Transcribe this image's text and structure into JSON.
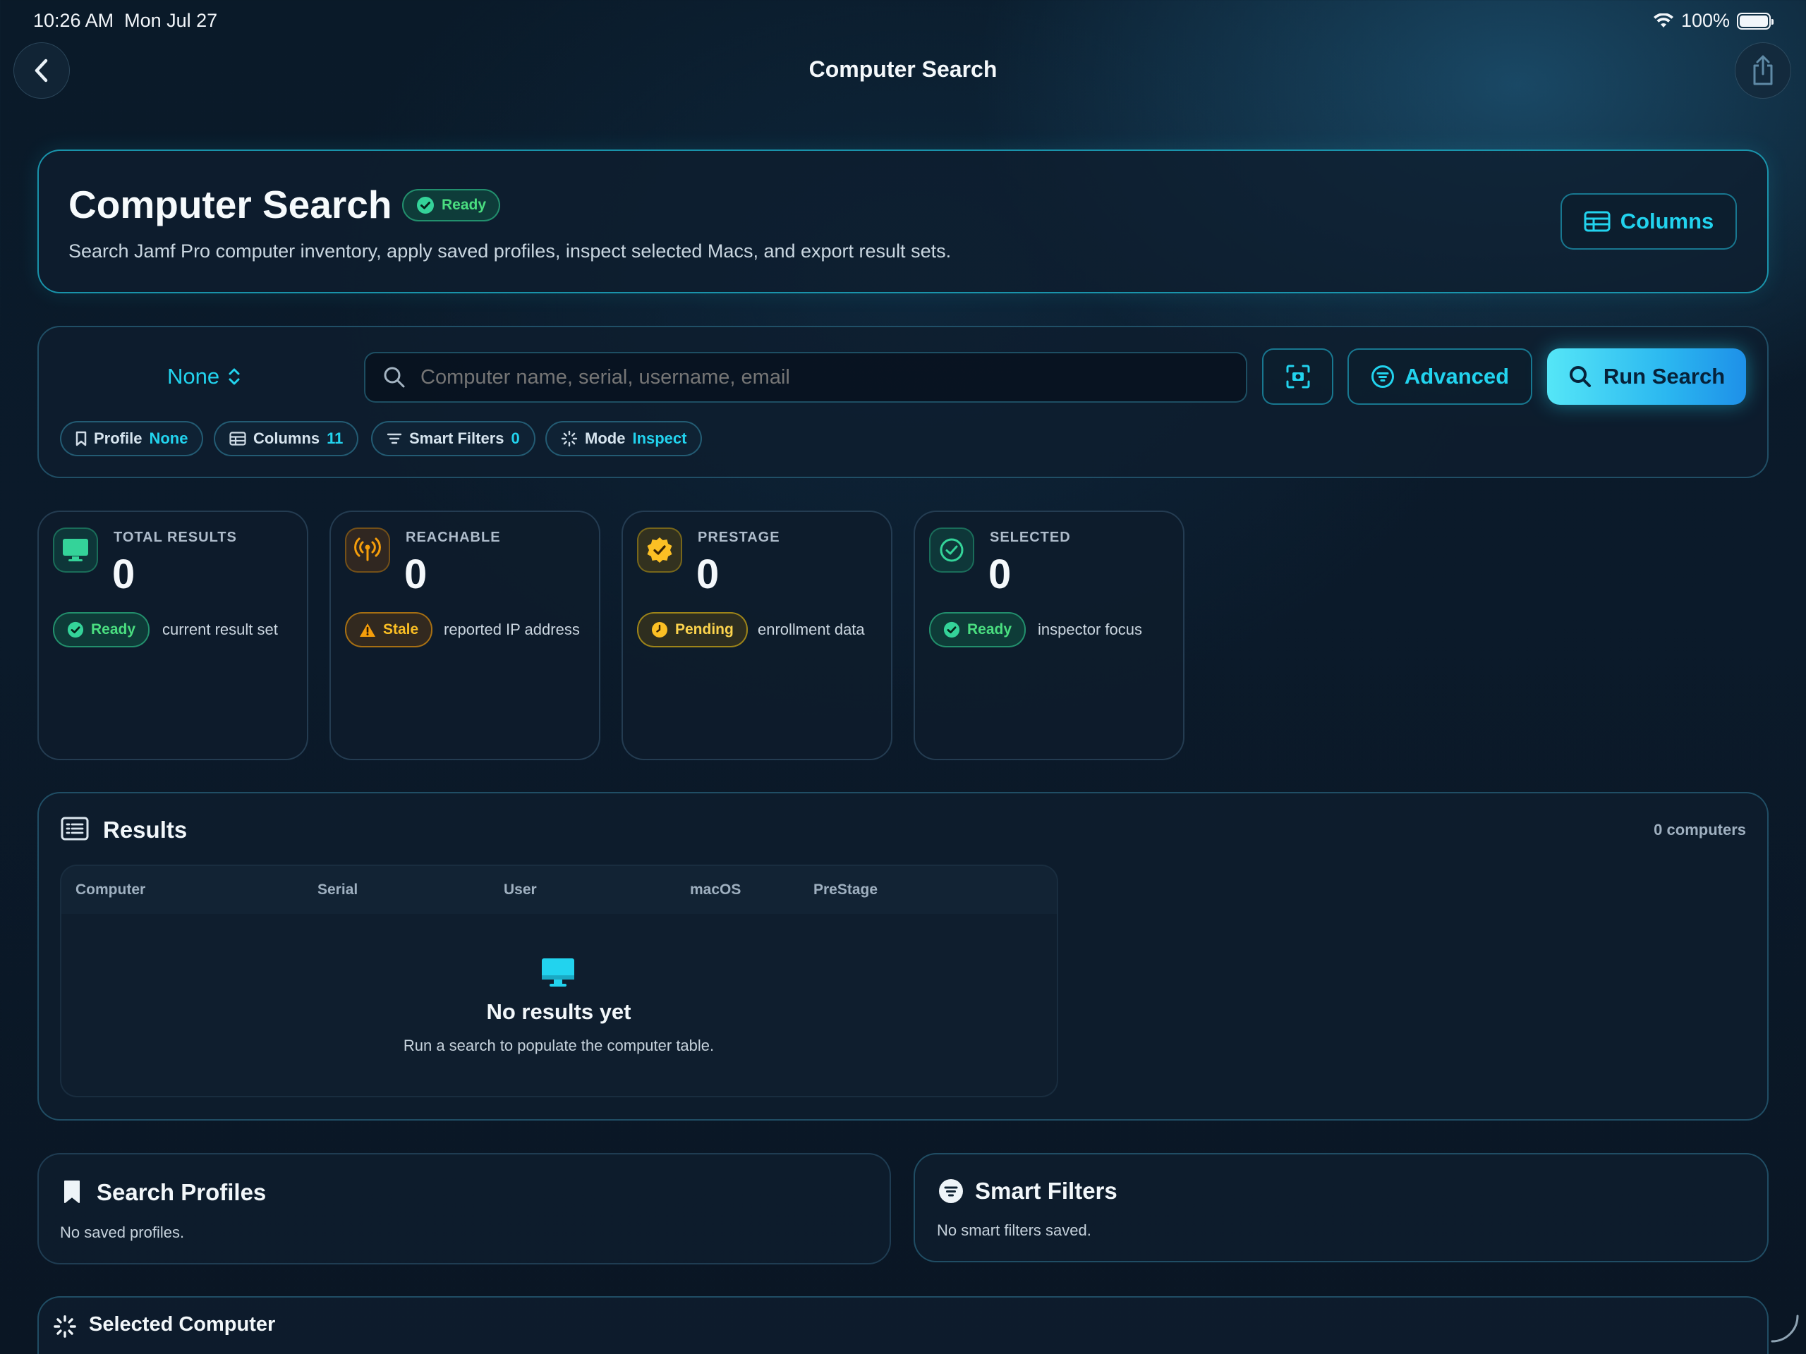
{
  "status_bar": {
    "time": "10:26 AM",
    "date": "Mon Jul 27",
    "battery": "100%"
  },
  "nav": {
    "title": "Computer Search"
  },
  "header": {
    "title": "Computer Search",
    "status": "Ready",
    "description": "Search Jamf Pro computer inventory, apply saved profiles, inspect selected Macs, and export result sets.",
    "columns_button": "Columns"
  },
  "search": {
    "profile_select": "None",
    "placeholder": "Computer name, serial, username, email",
    "advanced_label": "Advanced",
    "run_label": "Run Search",
    "chips": [
      {
        "label": "Profile",
        "value": "None"
      },
      {
        "label": "Columns",
        "value": "11"
      },
      {
        "label": "Smart Filters",
        "value": "0"
      },
      {
        "label": "Mode",
        "value": "Inspect"
      }
    ]
  },
  "stats": [
    {
      "label": "TOTAL RESULTS",
      "value": "0",
      "badge": "Ready",
      "note": "current result set",
      "icon": "desktop-icon"
    },
    {
      "label": "REACHABLE",
      "value": "0",
      "badge": "Stale",
      "note": "reported IP address",
      "icon": "antenna-icon"
    },
    {
      "label": "PRESTAGE",
      "value": "0",
      "badge": "Pending",
      "note": "enrollment data",
      "icon": "seal-check-icon"
    },
    {
      "label": "SELECTED",
      "value": "0",
      "badge": "Ready",
      "note": "inspector focus",
      "icon": "checkmark-circle-icon"
    }
  ],
  "results": {
    "title": "Results",
    "count": "0 computers",
    "columns": [
      "Computer",
      "Serial",
      "User",
      "macOS",
      "PreStage"
    ],
    "empty_title": "No results yet",
    "empty_text": "Run a search to populate the computer table."
  },
  "profiles": {
    "title": "Search Profiles",
    "empty": "No saved profiles."
  },
  "smart_filters": {
    "title": "Smart Filters",
    "empty": "No smart filters saved."
  },
  "selected": {
    "title": "Selected Computer"
  },
  "colors": {
    "accent": "#22d3ee",
    "green": "#4ade80",
    "orange": "#fbbf24",
    "background": "#0b1a2a"
  }
}
